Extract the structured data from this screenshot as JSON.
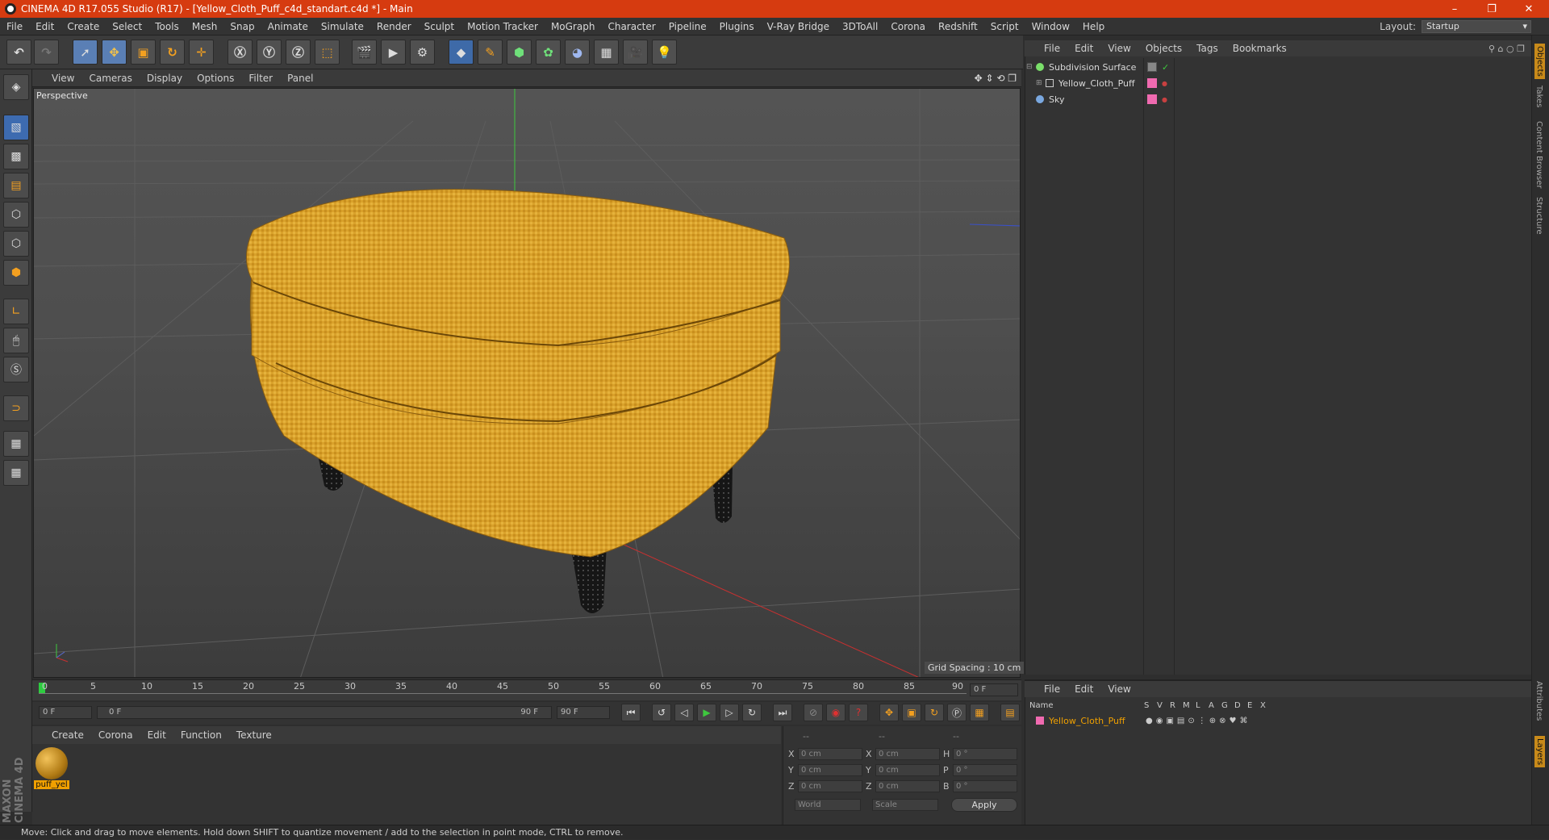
{
  "window": {
    "title": "CINEMA 4D R17.055 Studio (R17) - [Yellow_Cloth_Puff_c4d_standart.c4d *] - Main",
    "controls": [
      "–",
      "❐",
      "✕"
    ]
  },
  "menu": [
    "File",
    "Edit",
    "Create",
    "Select",
    "Tools",
    "Mesh",
    "Snap",
    "Animate",
    "Simulate",
    "Render",
    "Sculpt",
    "Motion Tracker",
    "MoGraph",
    "Character",
    "Pipeline",
    "Plugins",
    "V-Ray Bridge",
    "3DToAll",
    "Corona",
    "Redshift",
    "Script",
    "Window",
    "Help"
  ],
  "layout": {
    "label": "Layout:",
    "value": "Startup"
  },
  "viewport": {
    "menu": [
      "View",
      "Cameras",
      "Display",
      "Options",
      "Filter",
      "Panel"
    ],
    "label": "Perspective",
    "grid_spacing": "Grid Spacing : 10 cm"
  },
  "timeline": {
    "ticks": [
      "0",
      "5",
      "10",
      "15",
      "20",
      "25",
      "30",
      "35",
      "40",
      "45",
      "50",
      "55",
      "60",
      "65",
      "70",
      "75",
      "80",
      "85",
      "90"
    ],
    "current_frame": "0 F",
    "start": "0 F",
    "range_start": "0 F",
    "range_end": "90 F",
    "end": "90 F"
  },
  "materials": {
    "menu": [
      "Create",
      "Corona",
      "Edit",
      "Function",
      "Texture"
    ],
    "items": [
      {
        "name": "puff_yel"
      }
    ]
  },
  "coordinates": {
    "header": [
      "--",
      "--",
      "--"
    ],
    "rows": [
      {
        "a": "X",
        "av": "0 cm",
        "b": "X",
        "bv": "0 cm",
        "c": "H",
        "cv": "0 °"
      },
      {
        "a": "Y",
        "av": "0 cm",
        "b": "Y",
        "bv": "0 cm",
        "c": "P",
        "cv": "0 °"
      },
      {
        "a": "Z",
        "av": "0 cm",
        "b": "Z",
        "bv": "0 cm",
        "c": "B",
        "cv": "0 °"
      }
    ],
    "mode1": "World",
    "mode2": "Scale",
    "apply": "Apply"
  },
  "objects": {
    "menu": [
      "File",
      "Edit",
      "View",
      "Objects",
      "Tags",
      "Bookmarks"
    ],
    "rows": [
      {
        "name": "Subdivision Surface",
        "color": "#7adf6a"
      },
      {
        "name": "Yellow_Cloth_Puff",
        "color": "#f06ab0"
      },
      {
        "name": "Sky",
        "color": "#7aa8e0"
      }
    ]
  },
  "attributes": {
    "menu": [
      "File",
      "Edit",
      "View"
    ],
    "columns": [
      "Name",
      "S",
      "V",
      "R",
      "M",
      "L",
      "A",
      "G",
      "D",
      "E",
      "X"
    ],
    "row": "Yellow_Cloth_Puff"
  },
  "side_tabs": [
    "Objects",
    "Takes",
    "Content Browser",
    "Structure",
    "Attributes",
    "Layers"
  ],
  "brand": "MAXON CINEMA 4D",
  "status": "Move: Click and drag to move elements. Hold down SHIFT to quantize movement / add to the selection in point mode, CTRL to remove.",
  "colors": {
    "title_bar": "#d63b10",
    "accent_selected": "#f0a000",
    "fabric": "#d9a12a"
  }
}
